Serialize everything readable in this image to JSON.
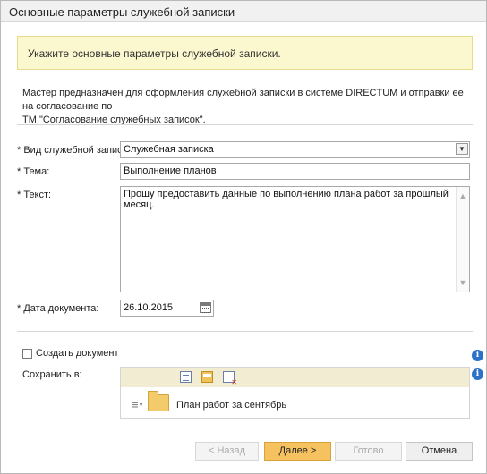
{
  "window": {
    "title": "Основные параметры служебной записки"
  },
  "hint": {
    "text": "Укажите основные параметры служебной записки."
  },
  "description": {
    "line1": "Мастер предназначен для оформления служебной записки в системе DIRECTUM и отправки ее на согласование по",
    "line2": "ТМ \"Согласование служебных записок\"."
  },
  "form": {
    "memo_type": {
      "label": "* Вид служебной записки:",
      "value": "Служебная записка"
    },
    "subject": {
      "label": "* Тема:",
      "value": "Выполнение планов"
    },
    "text": {
      "label": "* Текст:",
      "value": "Прошу предоставить данные по выполнению плана работ за прошлый месяц."
    },
    "doc_date": {
      "label": "* Дата документа:",
      "value": "26.10.2015"
    }
  },
  "create_document": {
    "label": "Создать документ",
    "checked": false
  },
  "save_to": {
    "label": "Сохранить в:",
    "folder": "План работ за сентябрь"
  },
  "buttons": {
    "back": "< Назад",
    "next": "Далее >",
    "done": "Готово",
    "cancel": "Отмена"
  },
  "icons": {
    "select_arrow": "chevron-down-icon",
    "calendar": "calendar-icon",
    "info": "info-icon",
    "toolbar_card": "card-icon",
    "toolbar_folder": "folder-icon",
    "toolbar_remove": "remove-icon",
    "menu": "menu-icon",
    "folder": "folder-icon"
  },
  "colors": {
    "hint_bg": "#fbf7cf",
    "primary_button": "#f6c15f",
    "info": "#2a73c8",
    "toolbar_bg": "#f2ecd3"
  }
}
